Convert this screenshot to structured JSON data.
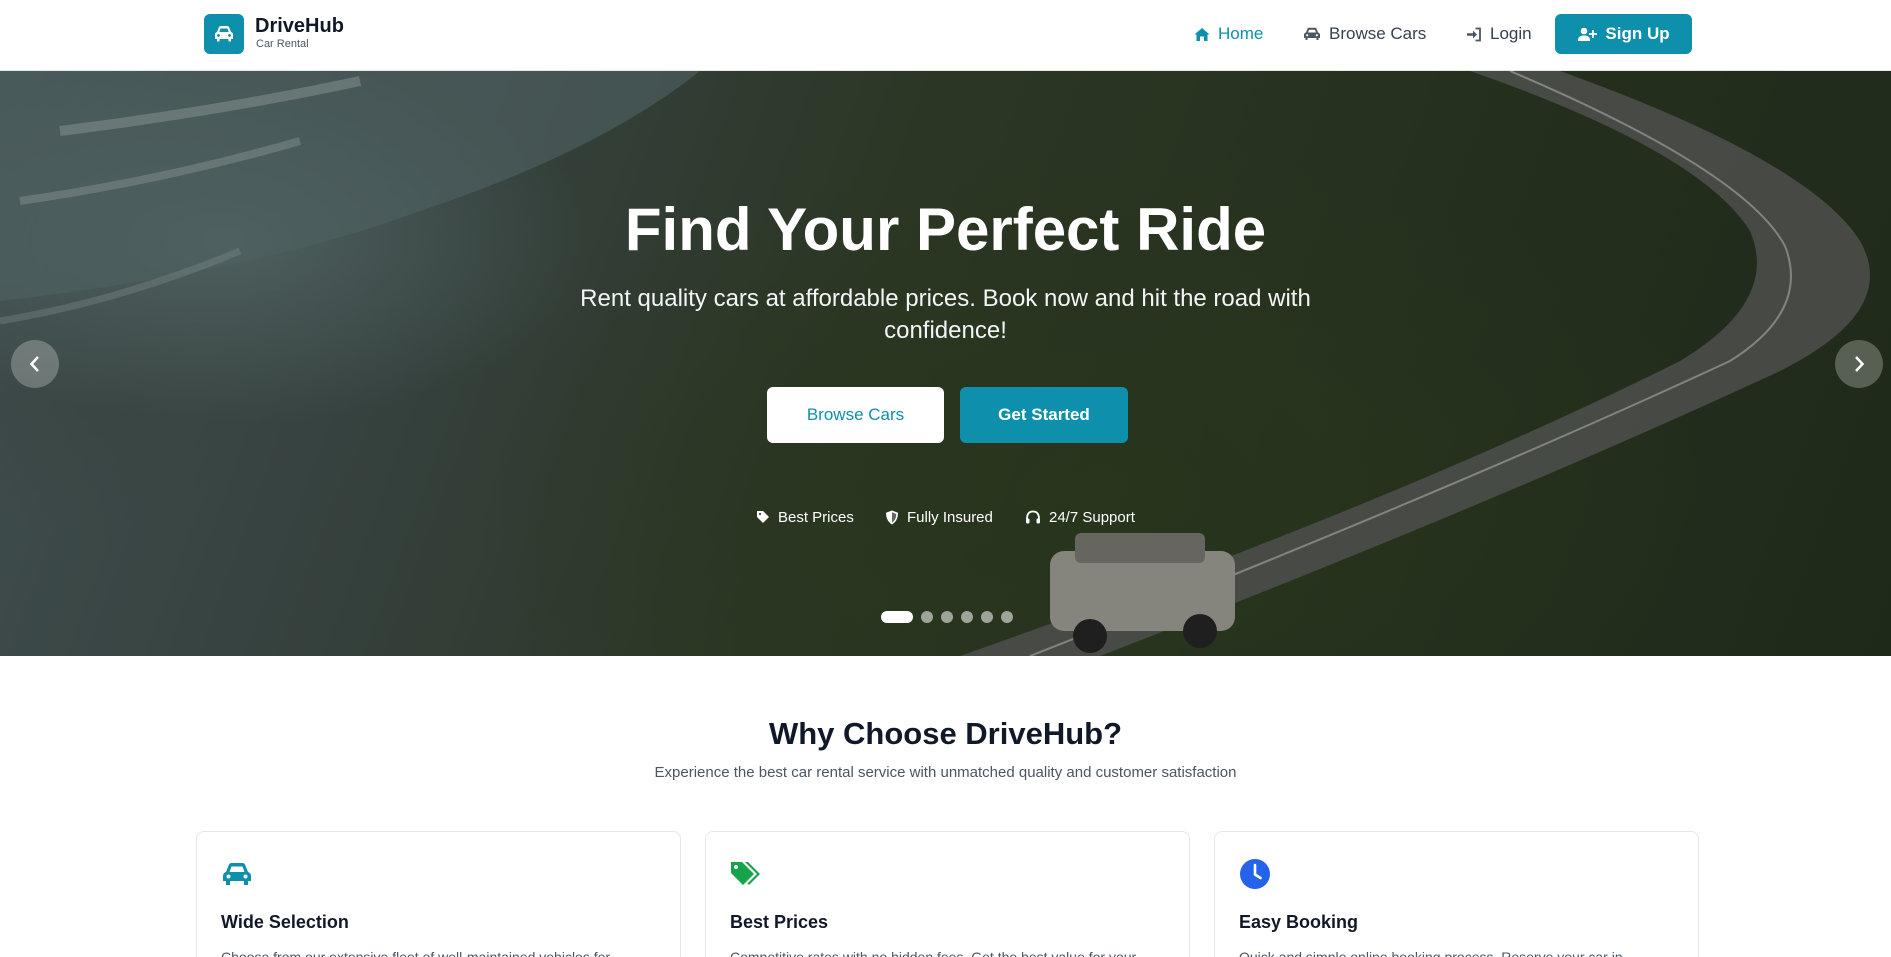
{
  "brand": {
    "name": "DriveHub",
    "tagline": "Car Rental"
  },
  "nav": {
    "home": "Home",
    "browse": "Browse Cars",
    "login": "Login",
    "signup": "Sign Up"
  },
  "hero": {
    "title": "Find Your Perfect Ride",
    "subtitle": "Rent quality cars at affordable prices. Book now and hit the road with confidence!",
    "primary_button": "Browse Cars",
    "secondary_button": "Get Started",
    "features": [
      "Best Prices",
      "Fully Insured",
      "24/7 Support"
    ],
    "carousel_slides": 6,
    "active_slide": 1
  },
  "why": {
    "title": "Why Choose DriveHub?",
    "subtitle": "Experience the best car rental service with unmatched quality and customer satisfaction",
    "cards": [
      {
        "icon": "car-icon",
        "title": "Wide Selection",
        "text": "Choose from our extensive fleet of well-maintained vehicles for"
      },
      {
        "icon": "tags-icon",
        "title": "Best Prices",
        "text": "Competitive rates with no hidden fees. Get the best value for your"
      },
      {
        "icon": "clock-icon",
        "title": "Easy Booking",
        "text": "Quick and simple online booking process. Reserve your car in"
      }
    ]
  },
  "colors": {
    "accent": "#0e8fab",
    "green": "#16a34a",
    "blue": "#2563eb"
  }
}
